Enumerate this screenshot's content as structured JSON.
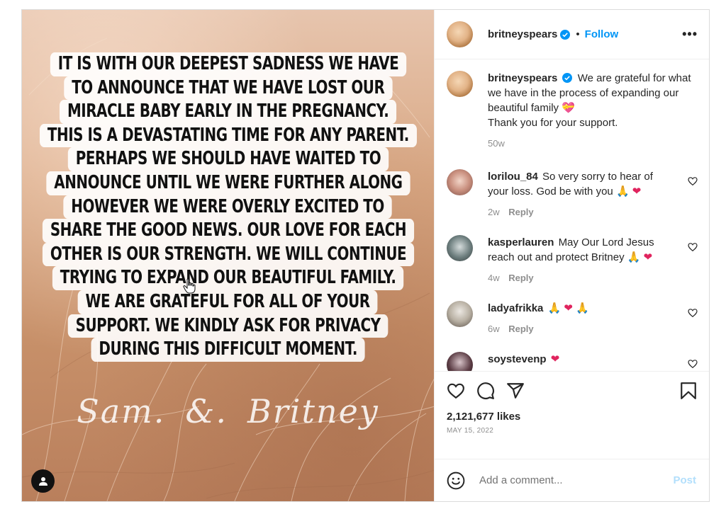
{
  "header": {
    "username": "britneyspears",
    "dot": "•",
    "follow_label": "Follow",
    "more_label": "•••"
  },
  "announcement": {
    "lines": [
      "It is with our deepest sadness we have",
      "to announce that we have lost our",
      "miracle baby early in the pregnancy.",
      "This is a devastating time for any parent.",
      "Perhaps we should have waited to",
      "announce until we were further along",
      "however we were overly excited to",
      "share the good news. Our love for each",
      "other is our strength. We will continue",
      "trying to expand our beautiful family.",
      "We are grateful for all of your",
      "support.  We kindly ask for privacy",
      "during this difficult moment."
    ],
    "signature": [
      "Sam.",
      "&.",
      "Britney"
    ]
  },
  "caption": {
    "username": "britneyspears",
    "text": "We are grateful for what we have in the process of expanding our beautiful family",
    "emoji": "💝",
    "text2": "Thank you for your support.",
    "age": "50w"
  },
  "comments": [
    {
      "username": "lorilou_84",
      "text": "So very sorry to hear of your loss. God be with you",
      "emoji": [
        "🙏",
        "❤"
      ],
      "age": "2w",
      "reply": "Reply"
    },
    {
      "username": "kasperlauren",
      "text": "May Our Lord Jesus reach out and protect Britney",
      "emoji": [
        "🙏",
        "❤"
      ],
      "age": "4w",
      "reply": "Reply"
    },
    {
      "username": "ladyafrikka",
      "text": "",
      "emoji": [
        "🙏",
        "❤",
        "🙏"
      ],
      "age": "6w",
      "reply": "Reply"
    },
    {
      "username": "soystevenp",
      "text": "",
      "emoji": [
        "❤"
      ],
      "age": "",
      "reply": ""
    }
  ],
  "stats": {
    "likes": "2,121,677 likes",
    "date": "MAY 15, 2022"
  },
  "add_comment": {
    "placeholder": "Add a comment...",
    "post_label": "Post"
  },
  "colors": {
    "accent": "#0095f6",
    "post_disabled": "#b2dffc",
    "heart": "#e0245e",
    "muted": "#8e8e8e"
  }
}
